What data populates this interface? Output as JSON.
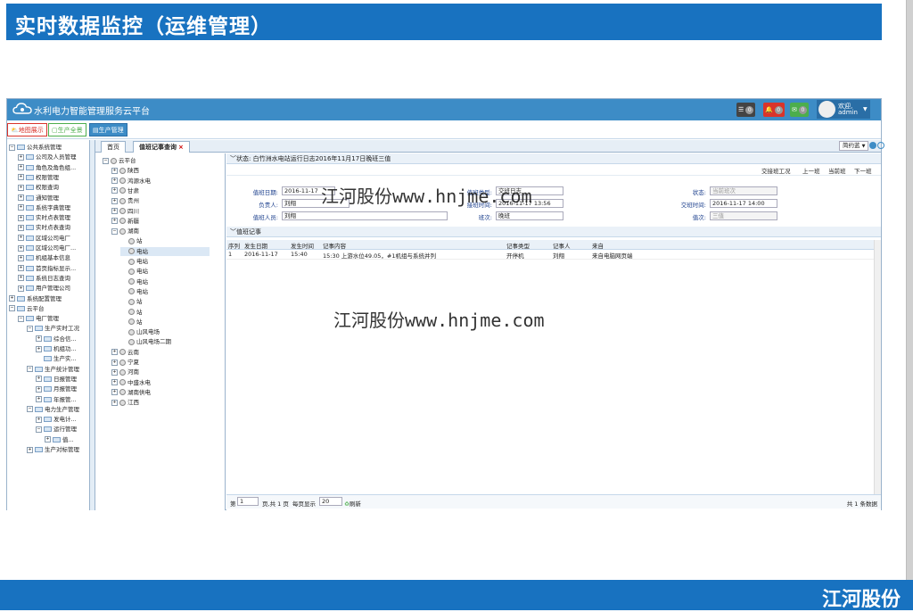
{
  "slide": {
    "title": "实时数据监控（运维管理）",
    "footer_logo": "江河股份",
    "watermark": "江河股份www.hnjme.com"
  },
  "app": {
    "title": "水利电力智能管理服务云平台",
    "notify": [
      {
        "color": "#444444",
        "count": "0"
      },
      {
        "color": "#d9342b",
        "count": "0"
      },
      {
        "color": "#4cae4c",
        "count": "0"
      }
    ],
    "user": {
      "greeting": "欢迎,",
      "name": "admin",
      "caret": "▼"
    }
  },
  "toolbar": {
    "buttons": [
      {
        "label": "地图展示",
        "color": "#d9342b"
      },
      {
        "label": "生产全景",
        "color": "#4cae4c"
      },
      {
        "label": "生产管理",
        "color": "#3d8cc6"
      }
    ]
  },
  "sidebar": {
    "items": [
      {
        "label": "公共系统管理",
        "depth": 0,
        "box": "−",
        "folder": true
      },
      {
        "label": "公司及人员管理",
        "depth": 1,
        "box": "+",
        "folder": true
      },
      {
        "label": "角色及角色组...",
        "depth": 1,
        "box": "+",
        "folder": true
      },
      {
        "label": "权限管理",
        "depth": 1,
        "box": "+",
        "folder": true
      },
      {
        "label": "权限查询",
        "depth": 1,
        "box": "+",
        "folder": true
      },
      {
        "label": "通知管理",
        "depth": 1,
        "box": "+",
        "folder": true
      },
      {
        "label": "系统字典管理",
        "depth": 1,
        "box": "+",
        "folder": true
      },
      {
        "label": "实时点表管理",
        "depth": 1,
        "box": "+",
        "folder": true
      },
      {
        "label": "实时点表查询",
        "depth": 1,
        "box": "+",
        "folder": true
      },
      {
        "label": "区域公司电厂",
        "depth": 1,
        "box": "+",
        "folder": true
      },
      {
        "label": "区域公司电厂...",
        "depth": 1,
        "box": "+",
        "folder": true
      },
      {
        "label": "机组基本信息",
        "depth": 1,
        "box": "+",
        "folder": true
      },
      {
        "label": "首页指标显示...",
        "depth": 1,
        "box": "+",
        "folder": true
      },
      {
        "label": "系统日志查询",
        "depth": 1,
        "box": "+",
        "folder": true
      },
      {
        "label": "用户管理公司",
        "depth": 1,
        "box": "+",
        "folder": true
      },
      {
        "label": "系统配置管理",
        "depth": 0,
        "box": "+",
        "folder": true
      },
      {
        "label": "云平台",
        "depth": 0,
        "box": "−",
        "folder": true
      },
      {
        "label": "电厂管理",
        "depth": 1,
        "box": "−",
        "folder": true
      },
      {
        "label": "生产实时工况",
        "depth": 2,
        "box": "−",
        "folder": true
      },
      {
        "label": "综合信...",
        "depth": 3,
        "box": "+",
        "folder": true
      },
      {
        "label": "机组功...",
        "depth": 3,
        "box": "+",
        "folder": true
      },
      {
        "label": "生产实...",
        "depth": 3,
        "box": "",
        "folder": true
      },
      {
        "label": "生产统计管理",
        "depth": 2,
        "box": "−",
        "folder": true
      },
      {
        "label": "日报管理",
        "depth": 3,
        "box": "+",
        "folder": true
      },
      {
        "label": "月报管理",
        "depth": 3,
        "box": "+",
        "folder": true
      },
      {
        "label": "年报管...",
        "depth": 3,
        "box": "+",
        "folder": true
      },
      {
        "label": "电力生产管理",
        "depth": 2,
        "box": "−",
        "folder": true
      },
      {
        "label": "发电计...",
        "depth": 3,
        "box": "+",
        "folder": true
      },
      {
        "label": "运行管理",
        "depth": 3,
        "box": "−",
        "folder": true
      },
      {
        "label": "值...",
        "depth": 4,
        "box": "+",
        "folder": true
      },
      {
        "label": "生产对标管理",
        "depth": 2,
        "box": "+",
        "folder": true
      }
    ]
  },
  "tabs": [
    {
      "label": "首页"
    },
    {
      "label": "值班记事查询"
    }
  ],
  "tab_close": "×",
  "theme_select": {
    "label": "简约蓝",
    "caret": "▼"
  },
  "regions": {
    "items": [
      {
        "label": "云平台",
        "depth": 0,
        "box": "−"
      },
      {
        "label": "陕西",
        "depth": 1,
        "box": "+"
      },
      {
        "label": "鸿源水电",
        "depth": 1,
        "box": "+"
      },
      {
        "label": "甘肃",
        "depth": 1,
        "box": "+"
      },
      {
        "label": "贵州",
        "depth": 1,
        "box": "+"
      },
      {
        "label": "四川",
        "depth": 1,
        "box": "+"
      },
      {
        "label": "新疆",
        "depth": 1,
        "box": "+"
      },
      {
        "label": "湖南",
        "depth": 1,
        "box": "−"
      },
      {
        "label": "站",
        "depth": 2,
        "box": ""
      },
      {
        "label": "电站",
        "depth": 2,
        "box": "",
        "selected": true
      },
      {
        "label": "电站",
        "depth": 2,
        "box": ""
      },
      {
        "label": "电站",
        "depth": 2,
        "box": ""
      },
      {
        "label": "电站",
        "depth": 2,
        "box": ""
      },
      {
        "label": "电站",
        "depth": 2,
        "box": ""
      },
      {
        "label": "站",
        "depth": 2,
        "box": ""
      },
      {
        "label": "站",
        "depth": 2,
        "box": ""
      },
      {
        "label": "站",
        "depth": 2,
        "box": ""
      },
      {
        "label": "山风电场",
        "depth": 2,
        "box": ""
      },
      {
        "label": "山风电场二期",
        "depth": 2,
        "box": ""
      },
      {
        "label": "云南",
        "depth": 1,
        "box": "+"
      },
      {
        "label": "宁夏",
        "depth": 1,
        "box": "+"
      },
      {
        "label": "河南",
        "depth": 1,
        "box": "+"
      },
      {
        "label": "中盛水电",
        "depth": 1,
        "box": "+"
      },
      {
        "label": "湖南供电",
        "depth": 1,
        "box": "+"
      },
      {
        "label": "江西",
        "depth": 1,
        "box": "+"
      }
    ]
  },
  "status_panel": {
    "title": "状态: 白竹洲水电站运行日志2016年11月17日晚班三值"
  },
  "shift_buttons": [
    {
      "label": "交接班工况"
    },
    {
      "label": "上一班"
    },
    {
      "label": "当前班"
    },
    {
      "label": "下一班"
    }
  ],
  "form": {
    "duty_date": {
      "label": "值班日期:",
      "value": "2016-11-17"
    },
    "duty_type": {
      "label": "值班类型:",
      "value": "交班日志"
    },
    "status": {
      "label": "状态:",
      "value": "当前班次"
    },
    "leader": {
      "label": "负责人:",
      "value": "刘翔"
    },
    "handover_time": {
      "label": "接班时间:",
      "value": "2016-11-17 13:56"
    },
    "shift_time": {
      "label": "交班时间:",
      "value": "2016-11-17 14:00"
    },
    "staff": {
      "label": "值班人员:",
      "value": "刘翔"
    },
    "shift": {
      "label": "班次:",
      "value": "晚班"
    },
    "value_field": {
      "label": "值次:",
      "value": "三值"
    }
  },
  "log_panel": {
    "title": "值班记事"
  },
  "table": {
    "headers": [
      "序列",
      "发生日期",
      "发生时间",
      "记事内容",
      "记事类型",
      "记事人",
      "来自"
    ],
    "rows": [
      [
        "1",
        "2016-11-17",
        "15:40",
        "15:30 上游水位49.05，#1机组与系统并列",
        "开停机",
        "刘翔",
        "来自电脑网页端"
      ]
    ]
  },
  "pager": {
    "page_prefix": "第",
    "page": "1",
    "page_suffix": "页,共 1 页",
    "per_page_label": "每页显示",
    "per_page": "20",
    "refresh": "刷新",
    "total": "共 1 条数据"
  }
}
